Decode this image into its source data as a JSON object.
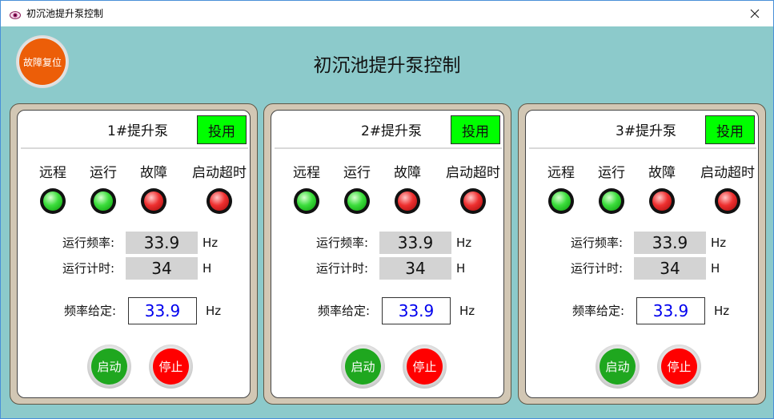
{
  "window": {
    "title": "初沉池提升泵控制"
  },
  "reset_button": {
    "label": "故障复位"
  },
  "main_title": "初沉池提升泵控制",
  "labels": {
    "status": [
      "远程",
      "运行",
      "故障",
      "启动超时"
    ],
    "run_freq": "运行频率:",
    "run_time": "运行计时:",
    "freq_set": "频率给定:",
    "unit_hz": "Hz",
    "unit_h": "H",
    "enable": "投用",
    "start": "启动",
    "stop": "停止"
  },
  "colors": {
    "lamp_on": "#22cc22",
    "lamp_fault": "#dd2222",
    "enabled": "#00ff00",
    "reset": "#ec5e08",
    "setpoint_text": "#0000ee"
  },
  "pumps": [
    {
      "name": "1#提升泵",
      "lamps": [
        "green",
        "green",
        "red",
        "red"
      ],
      "run_freq": "33.9",
      "run_time": "34",
      "freq_set": "33.9"
    },
    {
      "name": "2#提升泵",
      "lamps": [
        "green",
        "green",
        "red",
        "red"
      ],
      "run_freq": "33.9",
      "run_time": "34",
      "freq_set": "33.9"
    },
    {
      "name": "3#提升泵",
      "lamps": [
        "green",
        "green",
        "red",
        "red"
      ],
      "run_freq": "33.9",
      "run_time": "34",
      "freq_set": "33.9"
    }
  ]
}
